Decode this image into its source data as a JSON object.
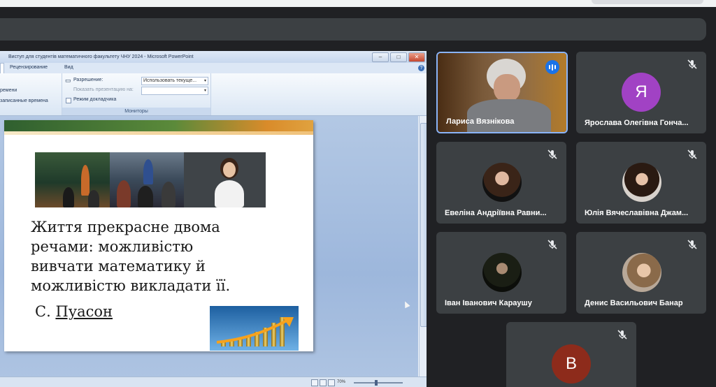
{
  "window": {
    "title": "Виступ для студентів математичного факультету ЧНУ 2024 - Microsoft PowerPoint"
  },
  "ribbon": {
    "tabs": [
      "Рецензирование",
      "Вид"
    ],
    "left_items": [
      "ремени",
      "записанные времена"
    ],
    "resolution_label": "Разрешение:",
    "resolution_value": "Использовать текуще...",
    "show_on_label": "Показать презентацию на:",
    "presenter_mode_label": "Режим докладчика",
    "group_caption": "Мониторы"
  },
  "status": {
    "zoom": "70%"
  },
  "slide": {
    "quote_lines": [
      "Життя прекрасне двома",
      "речами: можливістю",
      "вивчати математику й",
      "можливістю викладати її."
    ],
    "author_initial": "С.",
    "author_name": "Пуасон"
  },
  "participants": [
    {
      "name": "Лариса Вязнікова",
      "type": "video",
      "speaking": true
    },
    {
      "name": "Ярослава Олегівна Гонча...",
      "type": "letter",
      "letter": "Я",
      "color": "#a142c4",
      "muted": true
    },
    {
      "name": "Евеліна Андріївна Равни...",
      "type": "photo",
      "muted": true
    },
    {
      "name": "Юлія Вячеславівна Джам...",
      "type": "photo",
      "muted": true
    },
    {
      "name": "Іван Іванович Караушу",
      "type": "photo",
      "muted": true
    },
    {
      "name": "Денис Васильович Банар",
      "type": "photo",
      "muted": true
    },
    {
      "name": "",
      "type": "letter",
      "letter": "В",
      "color": "#8d2b1b",
      "muted": true
    }
  ],
  "icons": [
    "mic-off-icon",
    "speaking-indicator-icon",
    "minimize-icon",
    "maximize-icon",
    "close-icon",
    "help-icon",
    "mouse-cursor-icon"
  ]
}
